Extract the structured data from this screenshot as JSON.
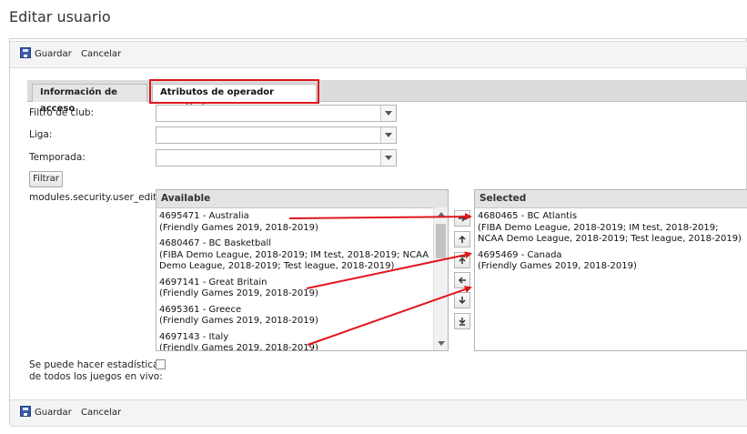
{
  "page": {
    "title": "Editar usuario"
  },
  "toolbar": {
    "save_label": "Guardar",
    "cancel_label": "Cancelar"
  },
  "tabs": [
    {
      "label": "Información de acceso",
      "active": false
    },
    {
      "label": "Atributos de operador estadístico",
      "active": true
    }
  ],
  "filters": {
    "club_label": "Filtro de club:",
    "league_label": "Liga:",
    "season_label": "Temporada:",
    "club_value": "",
    "league_value": "",
    "season_value": "",
    "filter_button": "Filtrar"
  },
  "teams": {
    "field_label": "modules.security.user_edit_form.team_statistics_op_teams:",
    "available_header": "Available",
    "selected_header": "Selected",
    "available": [
      {
        "name": "4695471 - Australia",
        "details": "(Friendly Games 2019, 2018-2019)"
      },
      {
        "name": "4680467 - BC Basketball",
        "details": "(FIBA Demo League, 2018-2019; IM test, 2018-2019; NCAA Demo League, 2018-2019; Test league, 2018-2019)"
      },
      {
        "name": "4697141 - Great Britain",
        "details": "(Friendly Games 2019, 2018-2019)"
      },
      {
        "name": "4695361 - Greece",
        "details": "(Friendly Games 2019, 2018-2019)"
      },
      {
        "name": "4697143 - Italy",
        "details": "(Friendly Games 2019, 2018-2019)"
      }
    ],
    "selected": [
      {
        "name": "4680465 - BC Atlantis",
        "details": "(FIBA Demo League, 2018-2019; IM test, 2018-2019; NCAA Demo League, 2018-2019; Test league, 2018-2019)"
      },
      {
        "name": "4695469 - Canada",
        "details": "(Friendly Games 2019, 2018-2019)"
      }
    ]
  },
  "live_stats": {
    "label_line1": "Se puede hacer estadísticas",
    "label_line2": "de todos los juegos en vivo:",
    "checked": false
  },
  "colors": {
    "annotation_red": "#e0161b",
    "toolbar_bg": "#f4f4f4",
    "tabbar_bg": "#dcdcdc"
  }
}
